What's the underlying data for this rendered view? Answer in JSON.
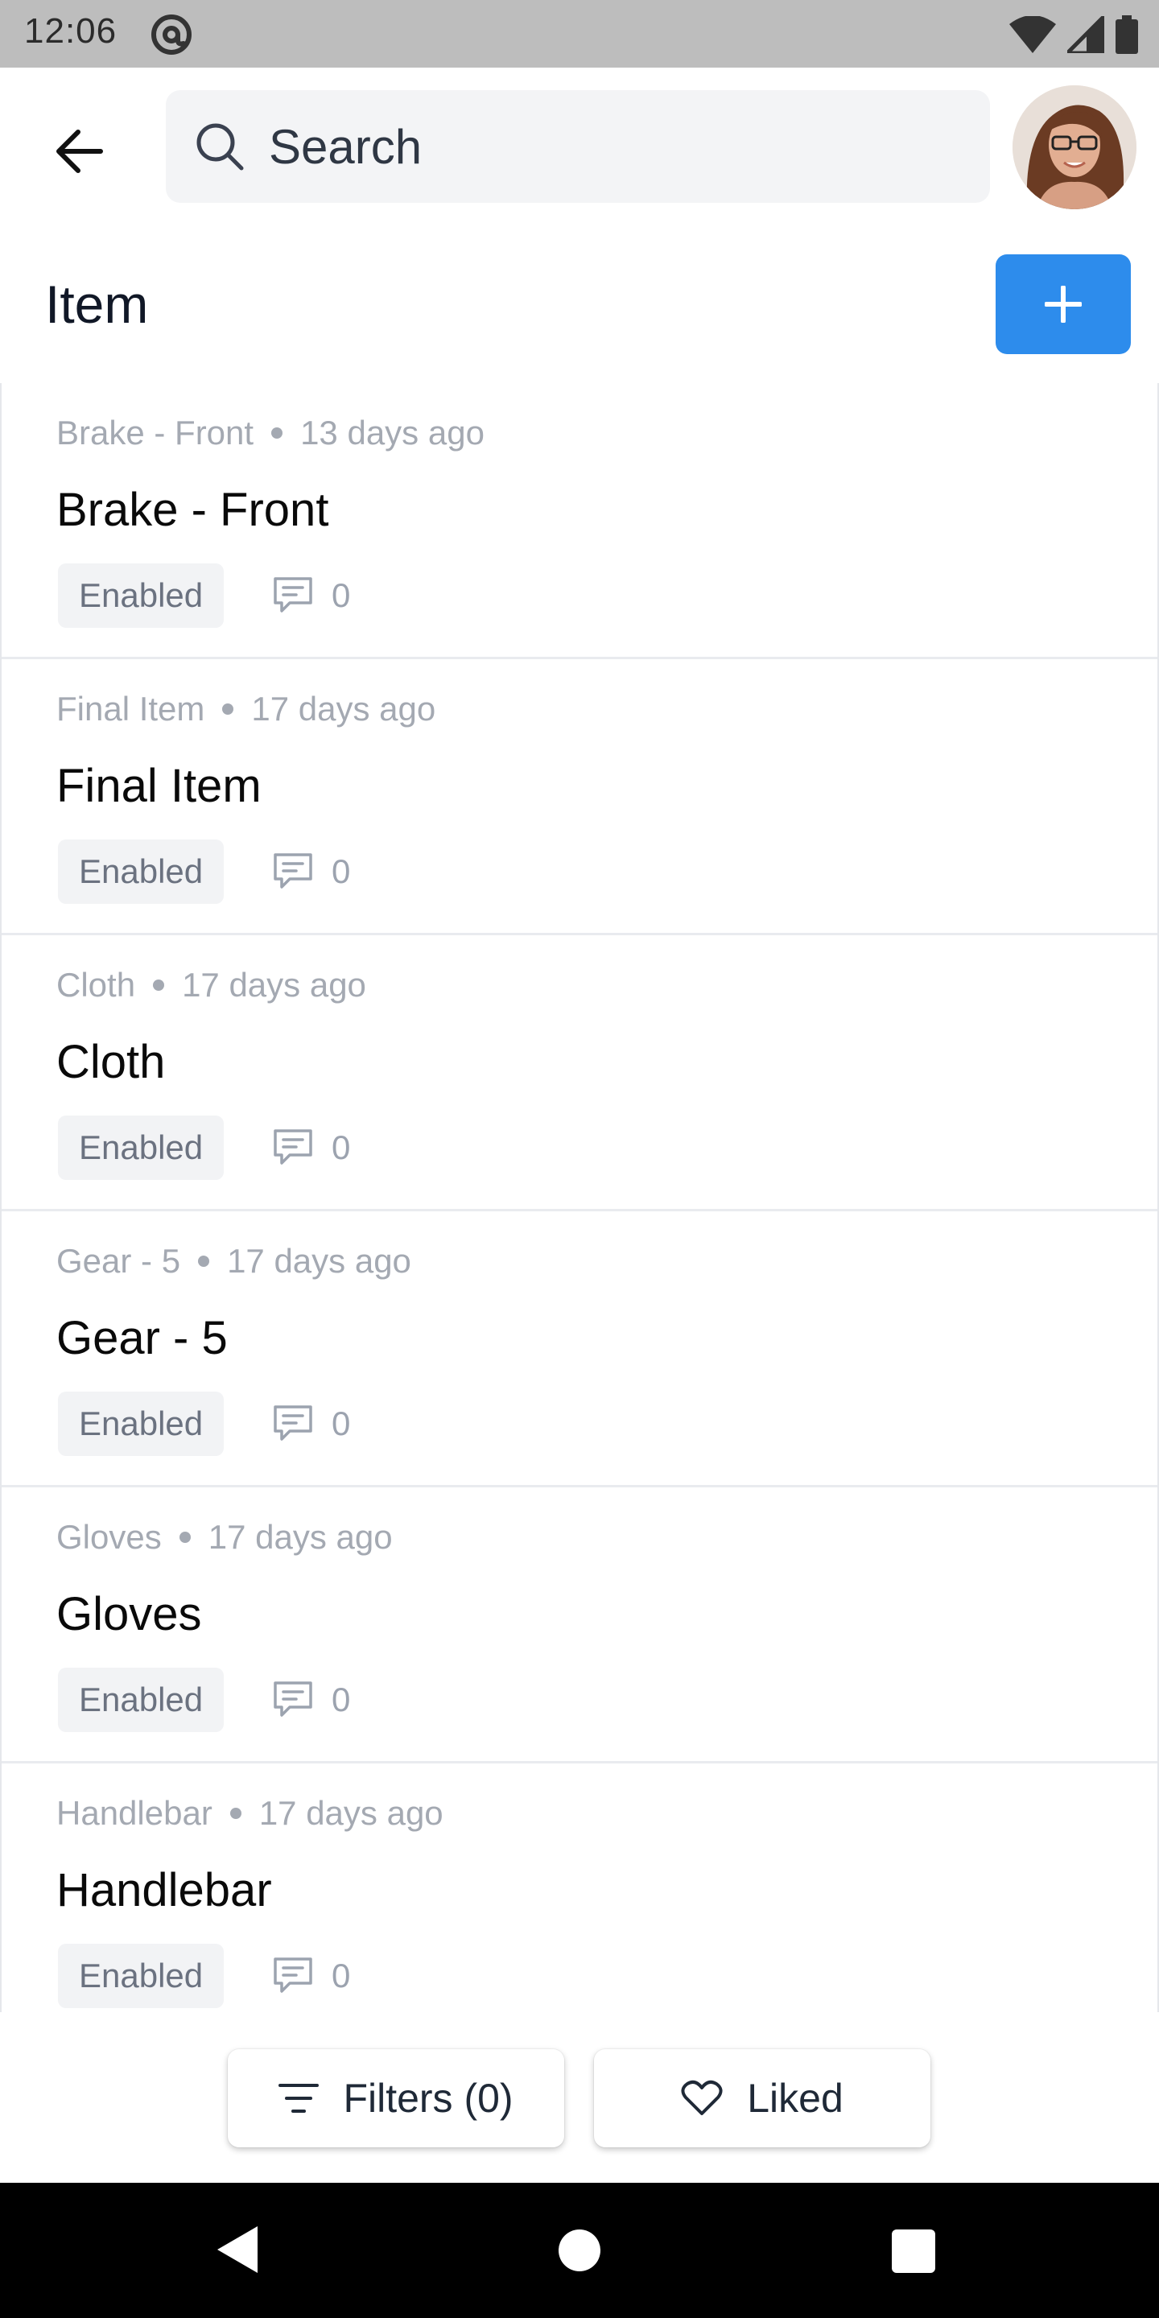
{
  "status_bar": {
    "time": "12:06",
    "icons": [
      "at-sign-icon",
      "wifi-icon",
      "signal-icon",
      "battery-icon"
    ]
  },
  "top_bar": {
    "back_icon": "arrow-left-icon",
    "search": {
      "placeholder": "Search",
      "icon": "search-icon"
    },
    "avatar": "user-avatar"
  },
  "header": {
    "title": "Item",
    "add_icon": "plus-icon",
    "accent_color": "#2d8cec"
  },
  "items": [
    {
      "meta_name": "Brake - Front",
      "age": "13 days ago",
      "title": "Brake - Front",
      "status": "Enabled",
      "comments": "0"
    },
    {
      "meta_name": "Final Item",
      "age": "17 days ago",
      "title": "Final Item",
      "status": "Enabled",
      "comments": "0"
    },
    {
      "meta_name": "Cloth",
      "age": "17 days ago",
      "title": "Cloth",
      "status": "Enabled",
      "comments": "0"
    },
    {
      "meta_name": "Gear - 5",
      "age": "17 days ago",
      "title": "Gear - 5",
      "status": "Enabled",
      "comments": "0"
    },
    {
      "meta_name": "Gloves",
      "age": "17 days ago",
      "title": "Gloves",
      "status": "Enabled",
      "comments": "0"
    },
    {
      "meta_name": "Handlebar",
      "age": "17 days ago",
      "title": "Handlebar",
      "status": "Enabled",
      "comments": "0"
    }
  ],
  "bottom_actions": {
    "filters_label": "Filters (0)",
    "filters_icon": "filter-lines-icon",
    "liked_label": "Liked",
    "liked_icon": "heart-icon"
  },
  "nav_bar": {
    "icons": [
      "nav-back-icon",
      "nav-home-icon",
      "nav-recents-icon"
    ]
  }
}
